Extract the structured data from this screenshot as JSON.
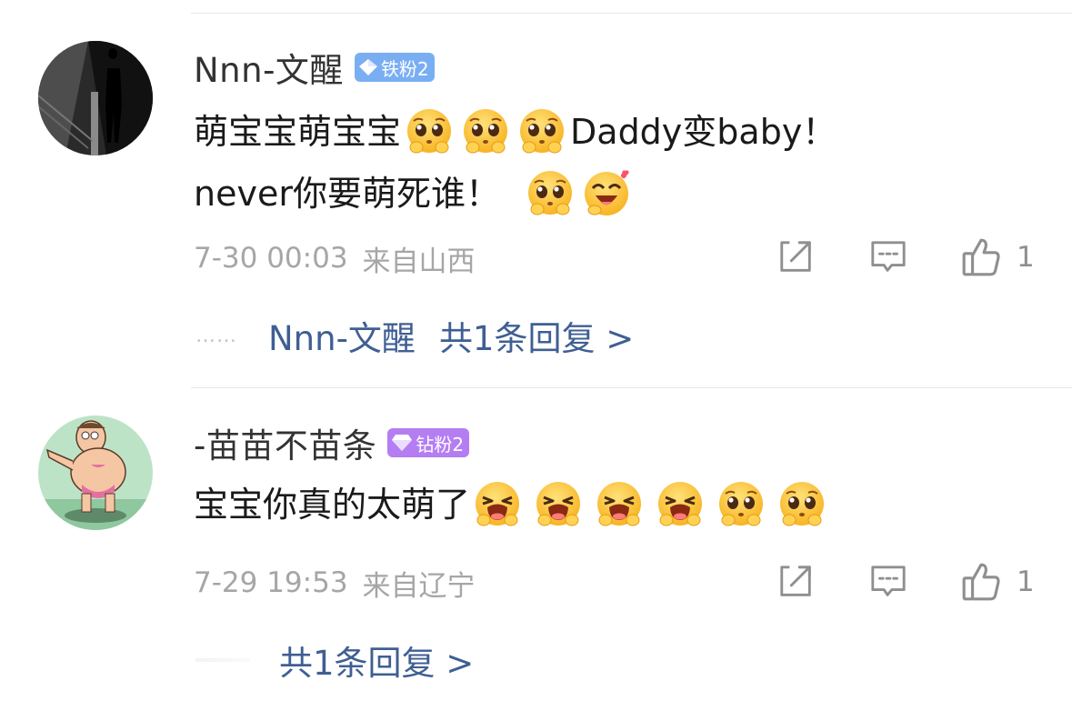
{
  "comments": [
    {
      "user": "Nnn-文醒",
      "badge": "铁粉2",
      "badge_color": "#7aaef3",
      "line1_text": "萌宝宝萌宝宝",
      "line1_tail": "Daddy变baby！",
      "line2_text": "never你要萌死谁！",
      "time": "7-30 00:03",
      "location": "来自山西",
      "likes": "1",
      "reply_user": "Nnn-文醒",
      "reply_link": "共1条回复 >"
    },
    {
      "user": "-苗苗不苗条",
      "badge": "钻粉2",
      "badge_color": "#b47ef2",
      "line1_text": "宝宝你真的太萌了",
      "time": "7-29 19:53",
      "location": "来自辽宁",
      "likes": "1",
      "reply_link": "共1条回复 >"
    }
  ],
  "icons": {
    "share": "share-icon",
    "comment": "comment-icon",
    "like": "thumbs-up-icon",
    "emoji_pleading": "pleading-face-emoji",
    "emoji_love": "heart-eyes-emoji",
    "emoji_cry": "crying-face-emoji"
  },
  "colors": {
    "link": "#3f5f93",
    "meta": "#a6a6a6",
    "emoji_face": "#ffc93c"
  }
}
